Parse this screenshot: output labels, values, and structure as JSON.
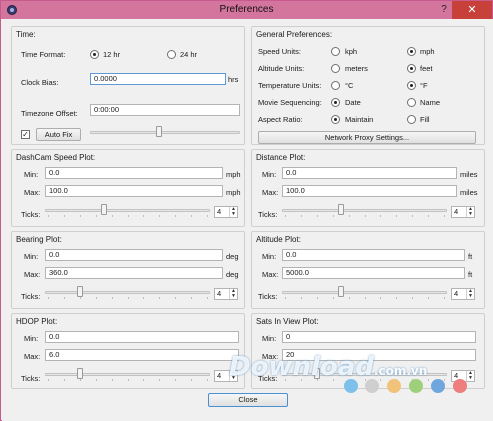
{
  "window": {
    "title": "Preferences",
    "help": "?",
    "close": "✕"
  },
  "time": {
    "title": "Time:",
    "format_label": "Time Format:",
    "opt_12": "12 hr",
    "opt_24": "24 hr",
    "bias_label": "Clock Bias:",
    "bias_value": "0.0000",
    "bias_unit": "hrs",
    "tz_label": "Timezone Offset:",
    "tz_value": "0:00:00",
    "autofix_checked": "✓",
    "autofix_label": "Auto Fix"
  },
  "general": {
    "title": "General Preferences:",
    "speed_label": "Speed Units:",
    "speed_a": "kph",
    "speed_b": "mph",
    "alt_label": "Altitude Units:",
    "alt_a": "meters",
    "alt_b": "feet",
    "temp_label": "Temperature Units:",
    "temp_a": "°C",
    "temp_b": "°F",
    "movie_label": "Movie Sequencing:",
    "movie_a": "Date",
    "movie_b": "Name",
    "aspect_label": "Aspect Ratio:",
    "aspect_a": "Maintain",
    "aspect_b": "Fill",
    "proxy_button": "Network Proxy Settings..."
  },
  "plots": {
    "min_label": "Min:",
    "max_label": "Max:",
    "ticks_label": "Ticks:",
    "dashcam": {
      "title": "DashCam Speed Plot:",
      "min": "0.0",
      "max": "100.0",
      "unit": "mph",
      "ticks": "4",
      "slider_level": 0.35
    },
    "distance": {
      "title": "Distance Plot:",
      "min": "0.0",
      "max": "100.0",
      "unit": "miles",
      "ticks": "4",
      "slider_level": 0.35
    },
    "bearing": {
      "title": "Bearing Plot:",
      "min": "0.0",
      "max": "360.0",
      "unit": "deg",
      "ticks": "4",
      "slider_level": 0.2
    },
    "altitude": {
      "title": "Altitude Plot:",
      "min": "0.0",
      "max": "5000.0",
      "unit": "ft",
      "ticks": "4",
      "slider_level": 0.35
    },
    "hdop": {
      "title": "HDOP Plot:",
      "min": "0.0",
      "max": "6.0",
      "unit": "",
      "ticks": "4",
      "slider_level": 0.2
    },
    "sats": {
      "title": "Sats In View Plot:",
      "min": "0",
      "max": "20",
      "unit": "",
      "ticks": "4",
      "slider_level": 0.2
    }
  },
  "footer": {
    "close_button": "Close"
  },
  "watermark": {
    "text": "Download",
    "suffix": ".com.vn"
  },
  "colors": {
    "titlebar": "#d4759e",
    "close": "#c7403a",
    "accent": "#4a8fd1"
  }
}
